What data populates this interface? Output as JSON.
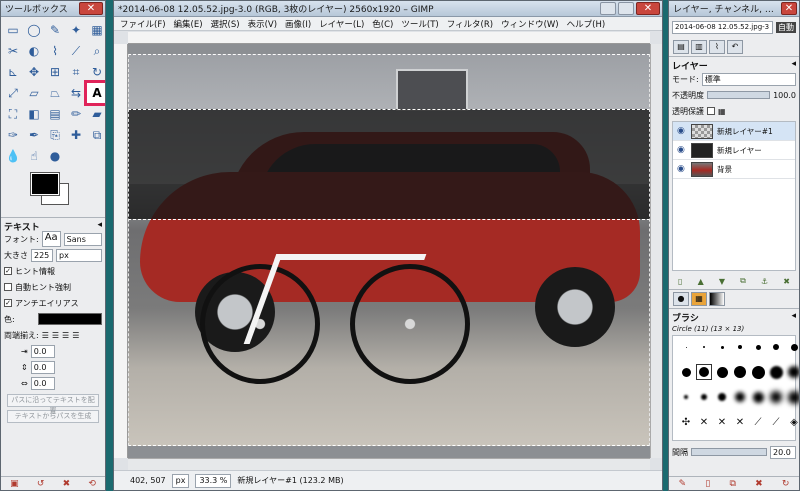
{
  "toolbox": {
    "title": "ツールボックス",
    "text_options_title": "テキスト",
    "font_label": "フォント:",
    "font_preview": "Aa",
    "font_value": "Sans",
    "size_label": "大きさ",
    "size_value": "225",
    "size_unit": "px",
    "hinting": "ヒント情報",
    "autohint": "自動ヒント強制",
    "antialias": "アンチエイリアス",
    "color_label": "色:",
    "justify_label": "両端揃え:",
    "indent_value": "0.0",
    "line_spacing_value": "0.0",
    "letter_spacing_value": "0.0",
    "text_along_path": "パスに沿ってテキストを配置",
    "path_from_text": "テキストからパスを生成"
  },
  "image_window": {
    "title": "*2014-06-08 12.05.52.jpg-3.0 (RGB, 3枚のレイヤー) 2560x1920 – GIMP",
    "menus": [
      "ファイル(F)",
      "編集(E)",
      "選択(S)",
      "表示(V)",
      "画像(I)",
      "レイヤー(L)",
      "色(C)",
      "ツール(T)",
      "フィルタ(R)",
      "ウィンドウ(W)",
      "ヘルプ(H)"
    ],
    "status": {
      "coords": "402, 507",
      "unit": "px",
      "zoom": "33.3 %",
      "message": "新規レイヤー#1 (123.2 MB)"
    }
  },
  "dock": {
    "title": "レイヤー, チャンネル, パス, ア...",
    "image_selector": "2014-06-08 12.05.52.jpg-3",
    "auto_label": "自動",
    "layers_title": "レイヤー",
    "mode_label": "モード:",
    "mode_value": "標準",
    "opacity_label": "不透明度",
    "opacity_value": "100.0",
    "lock_label": "透明保護",
    "layers": [
      {
        "name": "新規レイヤー#1"
      },
      {
        "name": "新規レイヤー"
      },
      {
        "name": "背景"
      }
    ],
    "brushes_title": "ブラシ",
    "brush_name": "Circle (11) (13 × 13)",
    "spacing_label": "間隔",
    "spacing_value": "20.0"
  },
  "colors": {
    "accent_highlight": "#e0245a",
    "fg_color": "#000000",
    "bg_color": "#ffffff"
  }
}
